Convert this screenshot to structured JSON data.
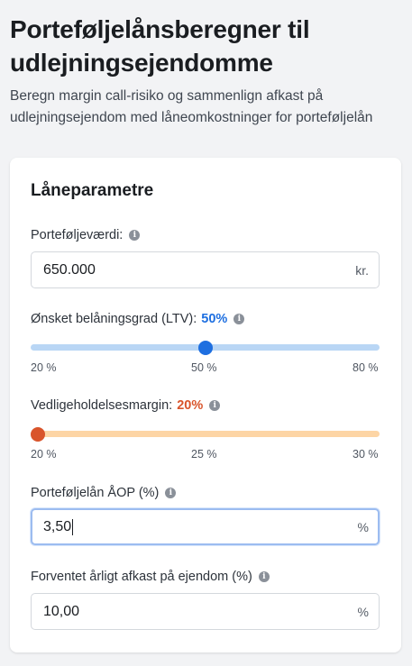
{
  "header": {
    "title": "Porteføljelånsberegner til udlejningsejendomme",
    "subtitle": "Beregn margin call-risiko og sammenlign afkast på udlejningsejendom med låneomkostninger for porteføljelån"
  },
  "card": {
    "title": "Låneparametre",
    "portfolio_value": {
      "label": "Porteføljeværdi:",
      "value": "650.000",
      "suffix": "kr."
    },
    "ltv": {
      "label": "Ønsket belåningsgrad (LTV):",
      "value_text": "50%",
      "value": 50,
      "min": 20,
      "max": 80,
      "ticks": [
        "20 %",
        "50 %",
        "80 %"
      ],
      "color": "#1e6fe0",
      "track_color": "#b9d6f5"
    },
    "maintenance_margin": {
      "label": "Vedligeholdelsesmargin:",
      "value_text": "20%",
      "value": 20,
      "min": 20,
      "max": 30,
      "ticks": [
        "20 %",
        "25 %",
        "30 %"
      ],
      "color": "#d9542b",
      "track_color": "#fdd5a5"
    },
    "apr": {
      "label": "Porteføljelån ÅOP (%)",
      "value": "3,50",
      "suffix": "%"
    },
    "return": {
      "label": "Forventet årligt afkast på ejendom (%)",
      "value": "10,00",
      "suffix": "%"
    }
  },
  "icons": {
    "info": "info-icon"
  }
}
